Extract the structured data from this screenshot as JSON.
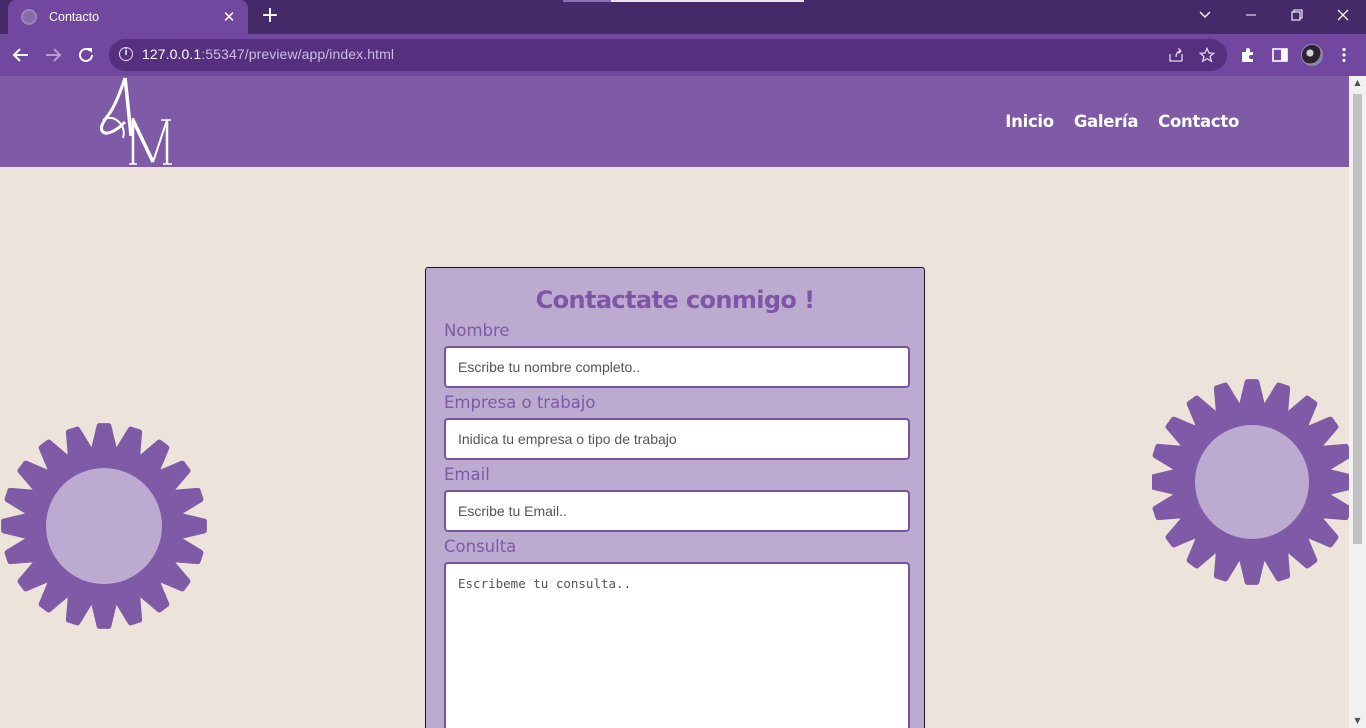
{
  "browser": {
    "tab_title": "Contacto",
    "url_host": "127.0.0.1",
    "url_rest": ":55347/preview/app/index.html"
  },
  "site": {
    "nav": [
      "Inicio",
      "Galería",
      "Contacto"
    ]
  },
  "form": {
    "title": "Contactate conmigo !",
    "fields": [
      {
        "label": "Nombre",
        "placeholder": "Escribe tu nombre completo.."
      },
      {
        "label": "Empresa o trabajo",
        "placeholder": "Inidica tu empresa o tipo de trabajo"
      },
      {
        "label": "Email",
        "placeholder": "Escribe tu Email.."
      },
      {
        "label": "Consulta",
        "placeholder": "Escribeme tu consulta.."
      }
    ]
  },
  "colors": {
    "header": "#7f5aa6",
    "page_bg": "#ede3da",
    "card_bg": "#bdaad1",
    "accent": "#7f55a8",
    "gear_outer": "#7f5aa6",
    "gear_inner": "#bdaad1"
  },
  "icons": {
    "back": "arrow-left-icon",
    "forward": "arrow-right-icon",
    "reload": "reload-icon",
    "share": "share-icon",
    "bookmark": "star-icon",
    "extensions": "puzzle-icon",
    "side_panel": "side-panel-icon",
    "menu": "kebab-menu-icon"
  }
}
